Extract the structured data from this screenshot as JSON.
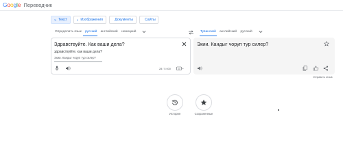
{
  "header": {
    "logo_word": "Google",
    "product": "Переводчик"
  },
  "modes": [
    {
      "label": "Текст",
      "active": true
    },
    {
      "label": "Изображения",
      "active": false
    },
    {
      "label": "Документы",
      "active": false
    },
    {
      "label": "Сайты",
      "active": false
    }
  ],
  "source_langs": {
    "detect": "Определить язык",
    "items": [
      "русский",
      "английский",
      "немецкий"
    ]
  },
  "target_langs": {
    "items": [
      "Тувинский",
      "английский",
      "русский"
    ]
  },
  "source": {
    "text": "Здравствуйте. Как ваши дела?",
    "suggestion": "здравствуйте. как ваши дела?",
    "transliteration": "Экии. Кандыг чоруп тур силер?",
    "char_count": "28 / 5 000"
  },
  "target": {
    "text": "Экии. Кандыг чоруп тур силер?",
    "feedback": "Отправить отзыв"
  },
  "bottom": {
    "history": "История",
    "saved": "Сохраненные"
  },
  "colors": {
    "accent": "#1a73e8",
    "panel_gray": "#f5f5f5",
    "border": "#dadce0"
  }
}
